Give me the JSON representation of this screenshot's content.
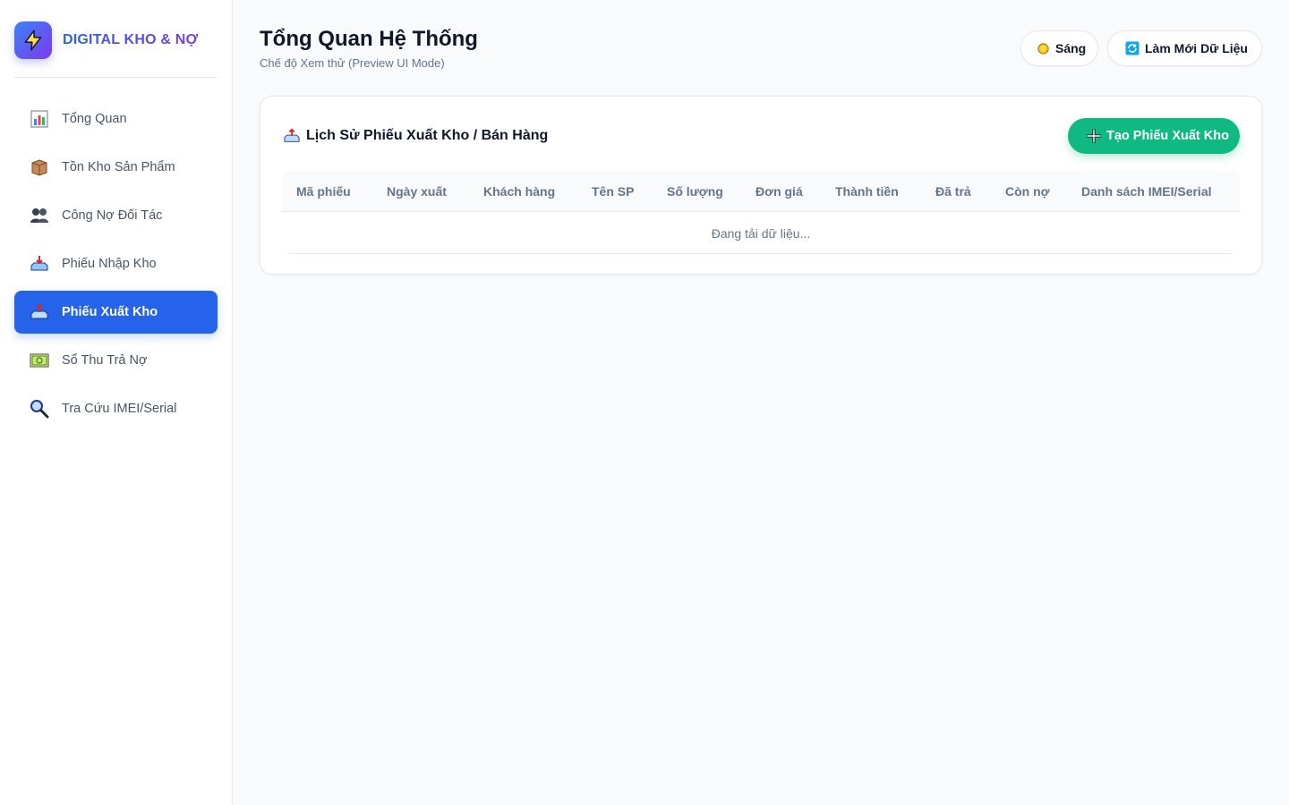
{
  "brand": {
    "name": "DIGITAL KHO & NỢ",
    "icon": "lightning-icon"
  },
  "sidebar": {
    "items": [
      {
        "label": "Tổng Quan",
        "icon": "bar-chart-icon",
        "active": false
      },
      {
        "label": "Tồn Kho Sản Phẩm",
        "icon": "box-icon",
        "active": false
      },
      {
        "label": "Công Nợ Đối Tác",
        "icon": "people-icon",
        "active": false
      },
      {
        "label": "Phiếu Nhập Kho",
        "icon": "inbox-tray-icon",
        "active": false
      },
      {
        "label": "Phiếu Xuất Kho",
        "icon": "outbox-tray-icon",
        "active": true
      },
      {
        "label": "Sổ Thu Trả Nợ",
        "icon": "ledger-icon",
        "active": false
      },
      {
        "label": "Tra Cứu IMEI/Serial",
        "icon": "magnifier-icon",
        "active": false
      }
    ]
  },
  "header": {
    "title": "Tổng Quan Hệ Thống",
    "subtitle": "Chế độ Xem thử (Preview UI Mode)",
    "theme_label": "Sáng",
    "refresh_label": "Làm Mới Dữ Liệu"
  },
  "card": {
    "title": "Lịch Sử Phiếu Xuất Kho / Bán Hàng",
    "create_label": "Tạo Phiếu Xuất Kho",
    "columns": [
      "Mã phiếu",
      "Ngày xuất",
      "Khách hàng",
      "Tên SP",
      "Số lượng",
      "Đơn giá",
      "Thành tiền",
      "Đã trả",
      "Còn nợ",
      "Danh sách IMEI/Serial"
    ],
    "loading_text": "Đang tải dữ liệu..."
  },
  "colors": {
    "accent": "#2563eb",
    "success": "#10b981",
    "brand_gradient_end": "#7c3aed"
  }
}
